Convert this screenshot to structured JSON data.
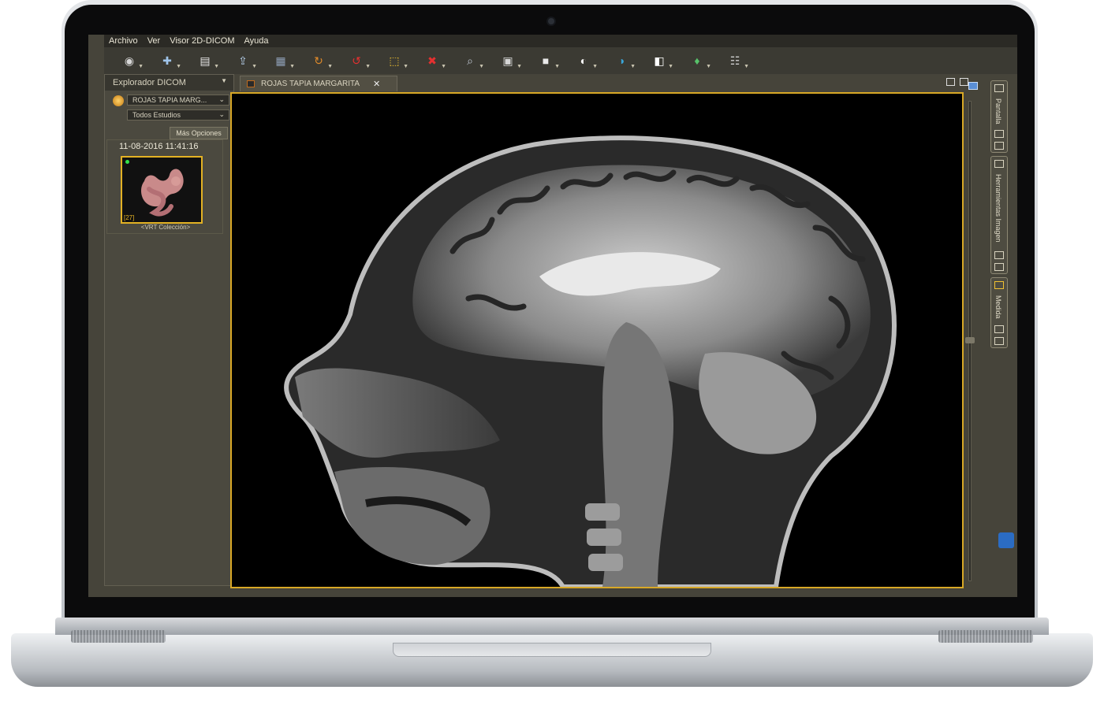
{
  "menu": {
    "items": [
      "Archivo",
      "Ver",
      "Visor 2D-DICOM",
      "Ayuda"
    ]
  },
  "toolbar": {
    "buttons": [
      {
        "icon": "disk-open-icon",
        "color": "#d7d7d7"
      },
      {
        "icon": "add-study-icon",
        "color": "#9fc4ea"
      },
      {
        "icon": "print-icon",
        "color": "#e7e7e7"
      },
      {
        "icon": "export-icon",
        "color": "#b9d3ef"
      },
      {
        "icon": "grid-layout-icon",
        "color": "#8fa0b8"
      },
      {
        "icon": "sync-icon",
        "color": "#e08a2a"
      },
      {
        "icon": "rotate-red-icon",
        "color": "#e53030"
      },
      {
        "icon": "select-area-icon",
        "color": "#f1c232"
      },
      {
        "icon": "delete-icon",
        "color": "#e53030"
      },
      {
        "icon": "zoom-icon",
        "color": "#c0c8d4"
      },
      {
        "icon": "save-image-icon",
        "color": "#d6d6d6"
      },
      {
        "icon": "lock-icon",
        "color": "#e9e9e9"
      },
      {
        "icon": "contrast-icon",
        "color": "#ffffff"
      },
      {
        "icon": "color-contrast-icon",
        "color": "#3aa6d9"
      },
      {
        "icon": "invert-icon",
        "color": "#ffffff"
      },
      {
        "icon": "3d-body-icon",
        "color": "#57c26a"
      },
      {
        "icon": "xray-icon",
        "color": "#cfcfcf"
      }
    ]
  },
  "left_panel": {
    "title": "Explorador DICOM",
    "patient_select": "ROJAS TAPIA MARG...",
    "studies_select": "Todos Estudios",
    "more_options": "Más Opciones",
    "study": {
      "date": "11-08-2016 11:41:16",
      "count": "[27]",
      "caption": "<VRT Colección>"
    }
  },
  "viewer": {
    "tab_label": "ROJAS TAPIA MARGARITA"
  },
  "right_rail": {
    "tabs": [
      "Pantalla",
      "Herramientas Imagen",
      "Medida"
    ]
  },
  "colors": {
    "accent": "#d8a826",
    "panel": "#46443a"
  }
}
